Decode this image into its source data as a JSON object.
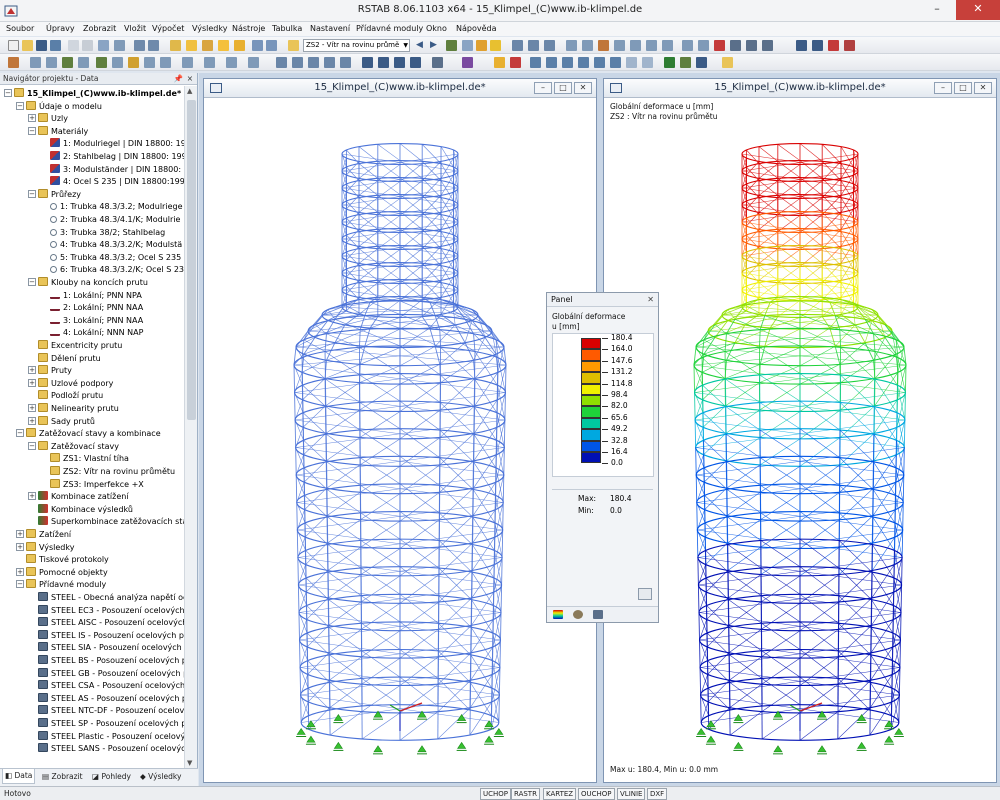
{
  "window": {
    "title": "RSTAB 8.06.1103 x64 - 15_Klimpel_(C)www.ib-klimpel.de",
    "minimize": "–",
    "maximize": "□",
    "close": "✕"
  },
  "menu": [
    "Soubor",
    "Úpravy",
    "Zobrazit",
    "Vložit",
    "Výpočet",
    "Výsledky",
    "Nástroje",
    "Tabulka",
    "Nastavení",
    "Přídavné moduly",
    "Okno",
    "Nápověda"
  ],
  "toolbar": {
    "loadcase_select": "ZS2 - Vítr na rovinu průmě"
  },
  "navigator": {
    "title": "Navigátor projektu - Data",
    "pin": "📌",
    "close": "×",
    "tree": [
      {
        "label": "15_Klimpel_(C)www.ib-klimpel.de*",
        "level": 0,
        "exp": "−",
        "icon": "folder",
        "bold": true
      },
      {
        "label": "Údaje o modelu",
        "level": 1,
        "exp": "−",
        "icon": "folder"
      },
      {
        "label": "Uzly",
        "level": 2,
        "exp": "+",
        "icon": "folder"
      },
      {
        "label": "Materiály",
        "level": 2,
        "exp": "−",
        "icon": "folder"
      },
      {
        "label": "1: Modulriegel | DIN 18800: 199",
        "level": 3,
        "icon": "mat"
      },
      {
        "label": "2: Stahlbelag | DIN 18800: 1990",
        "level": 3,
        "icon": "mat"
      },
      {
        "label": "3: Modulständer | DIN 18800: 1",
        "level": 3,
        "icon": "mat"
      },
      {
        "label": "4: Ocel S 235 | DIN 18800:1990-",
        "level": 3,
        "icon": "mat"
      },
      {
        "label": "Průřezy",
        "level": 2,
        "exp": "−",
        "icon": "folder"
      },
      {
        "label": "1: Trubka 48.3/3.2; Modulriege",
        "level": 3,
        "icon": "circle"
      },
      {
        "label": "2: Trubka 48.3/4.1/K; Modulrie",
        "level": 3,
        "icon": "circle"
      },
      {
        "label": "3: Trubka 38/2; Stahlbelag",
        "level": 3,
        "icon": "circle"
      },
      {
        "label": "4: Trubka 48.3/3.2/K; Modulstä",
        "level": 3,
        "icon": "circle"
      },
      {
        "label": "5: Trubka 48.3/3.2; Ocel S 235",
        "level": 3,
        "icon": "circle"
      },
      {
        "label": "6: Trubka 48.3/3.2/K; Ocel S 23",
        "level": 3,
        "icon": "circle"
      },
      {
        "label": "Klouby na koncích prutu",
        "level": 2,
        "exp": "−",
        "icon": "folder"
      },
      {
        "label": "1: Lokální; PNN NPA",
        "level": 3,
        "icon": "hinge"
      },
      {
        "label": "2: Lokální; PNN NAA",
        "level": 3,
        "icon": "hinge"
      },
      {
        "label": "3: Lokální; PNN NAA",
        "level": 3,
        "icon": "hinge"
      },
      {
        "label": "4: Lokální; NNN NAP",
        "level": 3,
        "icon": "hinge"
      },
      {
        "label": "Excentricity prutu",
        "level": 2,
        "icon": "folder"
      },
      {
        "label": "Dělení prutu",
        "level": 2,
        "icon": "folder"
      },
      {
        "label": "Pruty",
        "level": 2,
        "exp": "+",
        "icon": "folder"
      },
      {
        "label": "Uzlové podpory",
        "level": 2,
        "exp": "+",
        "icon": "folder"
      },
      {
        "label": "Podloží prutu",
        "level": 2,
        "icon": "folder"
      },
      {
        "label": "Nelinearity prutu",
        "level": 2,
        "exp": "+",
        "icon": "folder"
      },
      {
        "label": "Sady prutů",
        "level": 2,
        "exp": "+",
        "icon": "folder"
      },
      {
        "label": "Zatěžovací stavy a kombinace",
        "level": 1,
        "exp": "−",
        "icon": "folder"
      },
      {
        "label": "Zatěžovací stavy",
        "level": 2,
        "exp": "−",
        "icon": "folder"
      },
      {
        "label": "ZS1: Vlastní tíha",
        "level": 3,
        "icon": "folder"
      },
      {
        "label": "ZS2: Vítr na rovinu průmětu",
        "level": 3,
        "icon": "folder"
      },
      {
        "label": "ZS3: Imperfekce +X",
        "level": 3,
        "icon": "folder"
      },
      {
        "label": "Kombinace zatížení",
        "level": 2,
        "exp": "+",
        "icon": "result"
      },
      {
        "label": "Kombinace výsledků",
        "level": 2,
        "icon": "result"
      },
      {
        "label": "Superkombinace zatěžovacích sta",
        "level": 2,
        "icon": "result"
      },
      {
        "label": "Zatížení",
        "level": 1,
        "exp": "+",
        "icon": "folder"
      },
      {
        "label": "Výsledky",
        "level": 1,
        "exp": "+",
        "icon": "folder"
      },
      {
        "label": "Tiskové protokoly",
        "level": 1,
        "icon": "folder"
      },
      {
        "label": "Pomocné objekty",
        "level": 1,
        "exp": "+",
        "icon": "folder"
      },
      {
        "label": "Přídavné moduly",
        "level": 1,
        "exp": "−",
        "icon": "folder"
      },
      {
        "label": "STEEL - Obecná analýza napětí oce",
        "level": 2,
        "icon": "module"
      },
      {
        "label": "STEEL EC3 - Posouzení ocelových",
        "level": 2,
        "icon": "module"
      },
      {
        "label": "STEEL AISC - Posouzení ocelových",
        "level": 2,
        "icon": "module"
      },
      {
        "label": "STEEL IS - Posouzení ocelových pr",
        "level": 2,
        "icon": "module"
      },
      {
        "label": "STEEL SIA - Posouzení ocelových p",
        "level": 2,
        "icon": "module"
      },
      {
        "label": "STEEL BS - Posouzení ocelových p",
        "level": 2,
        "icon": "module"
      },
      {
        "label": "STEEL GB - Posouzení ocelových p",
        "level": 2,
        "icon": "module"
      },
      {
        "label": "STEEL CSA - Posouzení ocelových",
        "level": 2,
        "icon": "module"
      },
      {
        "label": "STEEL AS - Posouzení ocelových p",
        "level": 2,
        "icon": "module"
      },
      {
        "label": "STEEL NTC-DF - Posouzení ocelov",
        "level": 2,
        "icon": "module"
      },
      {
        "label": "STEEL SP - Posouzení ocelových p",
        "level": 2,
        "icon": "module"
      },
      {
        "label": "STEEL Plastic - Posouzení ocelový",
        "level": 2,
        "icon": "module"
      },
      {
        "label": "STEEL SANS - Posouzení ocelovýc",
        "level": 2,
        "icon": "module"
      }
    ],
    "tabs": [
      "Data",
      "Zobrazit",
      "Pohledy",
      "Výsledky"
    ]
  },
  "window1": {
    "title": "15_Klimpel_(C)www.ib-klimpel.de*"
  },
  "window2": {
    "title": "15_Klimpel_(C)www.ib-klimpel.de*",
    "overlay_line1": "Globální deformace u [mm]",
    "overlay_line2": "ZS2 : Vítr na rovinu průmětu",
    "footer": "Max u: 180.4, Min u: 0.0 mm"
  },
  "panel": {
    "title": "Panel",
    "close": "✕",
    "label1": "Globální deformace",
    "label2": "u [mm]",
    "legend_values": [
      "180.4",
      "164.0",
      "147.6",
      "131.2",
      "114.8",
      "98.4",
      "82.0",
      "65.6",
      "49.2",
      "32.8",
      "16.4",
      "0.0"
    ],
    "legend_colors": [
      "#d90000",
      "#ff5a00",
      "#ff9a00",
      "#ddbf00",
      "#f0f000",
      "#8fe000",
      "#1fd23a",
      "#00c8a0",
      "#00a8e0",
      "#0055e6",
      "#0010b4"
    ],
    "max_label": "Max:",
    "max_value": "180.4",
    "min_label": "Min:",
    "min_value": "0.0"
  },
  "status": {
    "text": "Hotovo",
    "cells": [
      "UCHOP",
      "RASTR",
      "KARTEZ",
      "OUCHOP",
      "VLINIE",
      "DXF"
    ]
  }
}
